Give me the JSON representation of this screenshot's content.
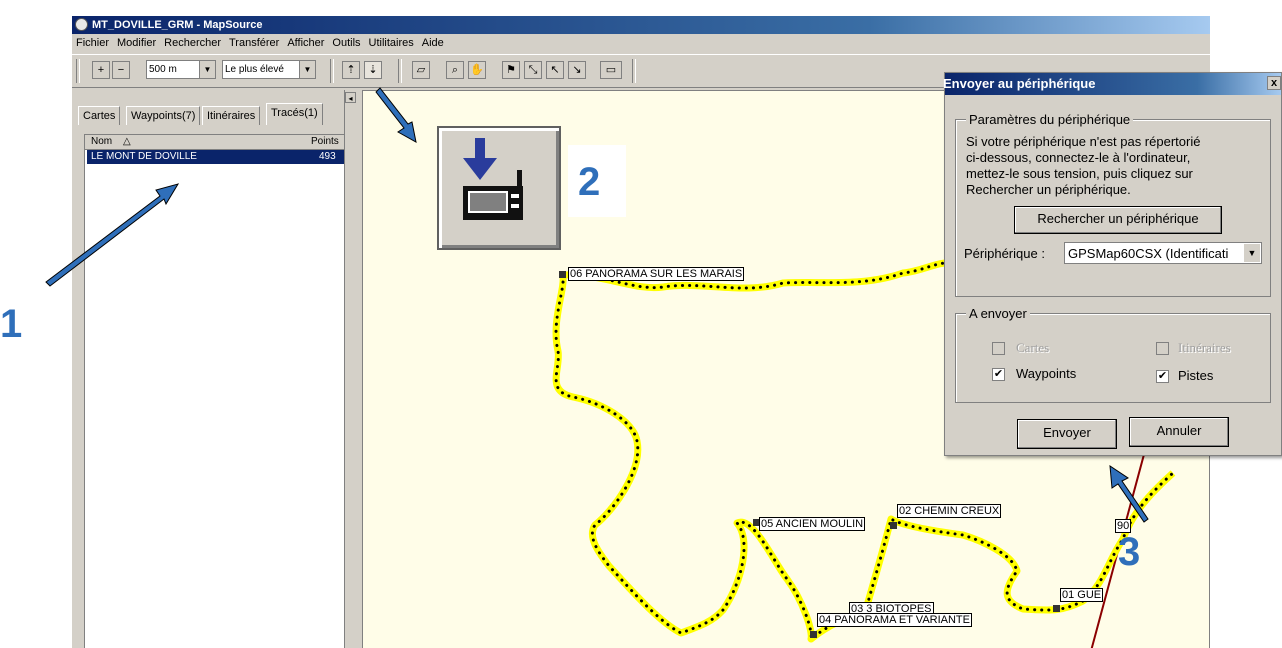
{
  "app": {
    "title": "MT_DOVILLE_GRM - MapSource",
    "menu": [
      "Fichier",
      "Modifier",
      "Rechercher",
      "Transférer",
      "Afficher",
      "Outils",
      "Utilitaires",
      "Aide"
    ],
    "toolbar": {
      "zoom_value": "500 m",
      "detail_value": "Le plus élevé"
    }
  },
  "left_panel": {
    "tabs": [
      "Cartes",
      "Waypoints(7)",
      "Itinéraires",
      "Tracés(1)"
    ],
    "active_tab": 3,
    "columns": {
      "name": "Nom",
      "points": "Points"
    },
    "rows": [
      {
        "name": "LE MONT DE DOVILLE",
        "points": "493"
      }
    ]
  },
  "map": {
    "waypoints": [
      "06 PANORAMA SUR LES MARAIS",
      "05 ANCIEN MOULIN",
      "02 CHEMIN CREUX",
      "03 3 BIOTOPES",
      "04 PANORAMA ET VARIANTE",
      "01 GUE",
      "90"
    ],
    "track_color": "#ffff00"
  },
  "dialog": {
    "title": "Envoyer au périphérique",
    "close": "x",
    "group1_label": "Paramètres du périphérique",
    "info_lines": [
      "Si votre périphérique n'est pas répertorié",
      "ci-dessous, connectez-le à l'ordinateur,",
      "mettez-le sous tension, puis cliquez sur",
      "Rechercher un périphérique."
    ],
    "search_button": "Rechercher un périphérique",
    "device_label": "Périphérique :",
    "device_value": "GPSMap60CSX (Identificati",
    "group2_label": "A envoyer",
    "options": {
      "cartes": "Cartes",
      "itineraires": "Itinéraires",
      "waypoints": "Waypoints",
      "pistes": "Pistes"
    },
    "send_button": "Envoyer",
    "cancel_button": "Annuler"
  },
  "annotations": {
    "n1": "1",
    "n2": "2",
    "n3": "3",
    "accent": "#2f6fba"
  }
}
